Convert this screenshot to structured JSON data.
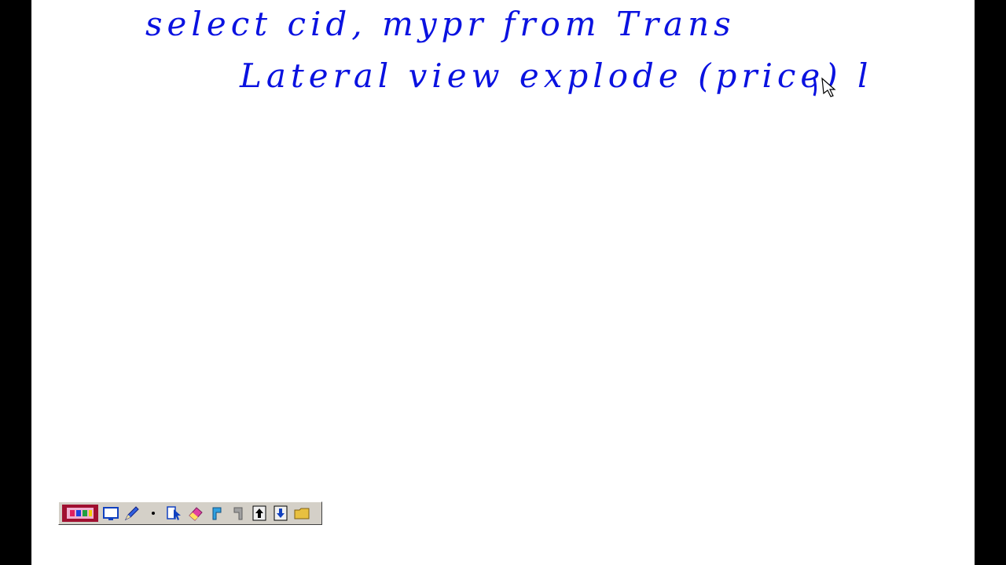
{
  "whiteboard": {
    "line1": "select cid, mypr from Trans",
    "line2": "Lateral view explode (price) l"
  },
  "colors": {
    "ink": "#0a12e0",
    "board": "#ffffff",
    "toolbar": "#d4d0c8"
  },
  "toolbar": {
    "buttons": [
      "color-palette-icon",
      "screen-icon",
      "pen-icon",
      "dot-size-icon",
      "select-icon",
      "eraser-icon",
      "undo-icon",
      "redo-icon",
      "page-up-icon",
      "page-down-icon",
      "folder-icon"
    ]
  }
}
